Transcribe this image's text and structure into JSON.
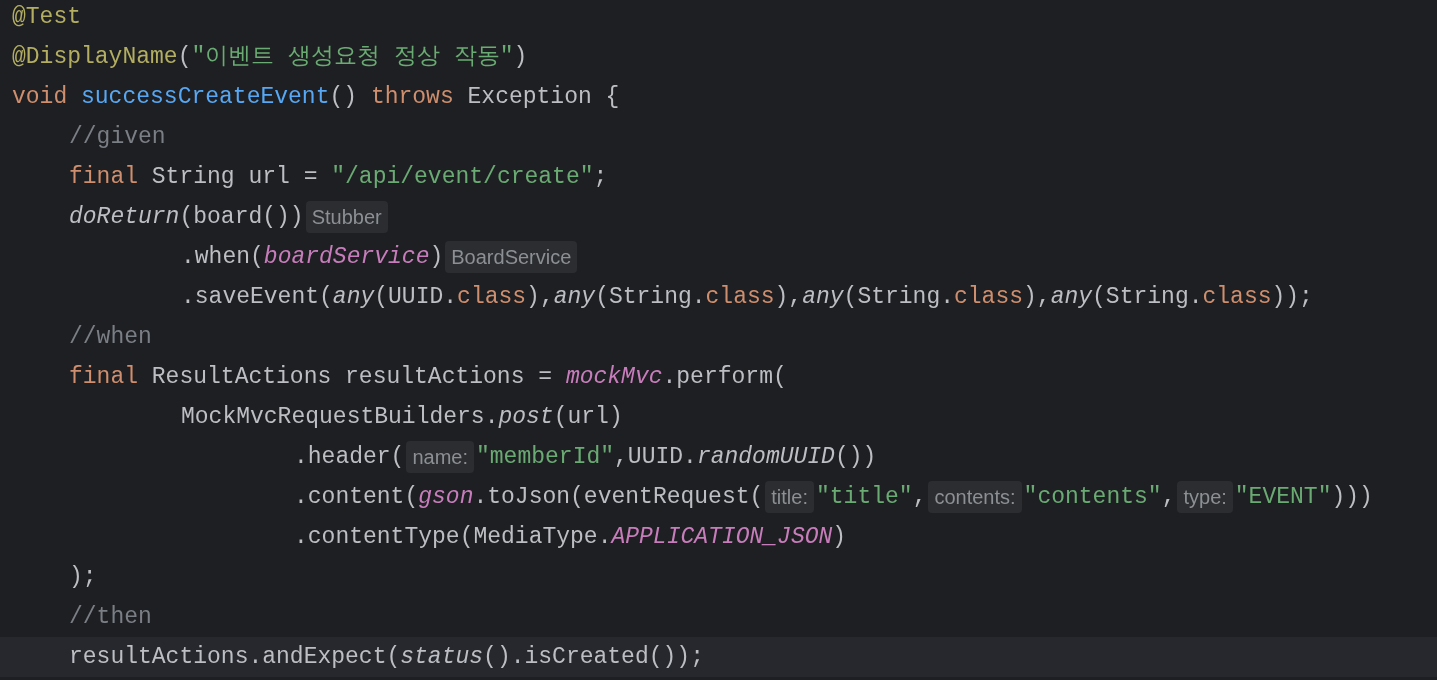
{
  "editor": {
    "lines": [
      {
        "current": false,
        "tokens": [
          {
            "kind": "annotation",
            "text": "@Test"
          }
        ]
      },
      {
        "current": false,
        "tokens": [
          {
            "kind": "annotation",
            "text": "@DisplayName"
          },
          {
            "kind": "plain",
            "text": "("
          },
          {
            "kind": "string",
            "text": "\"이벤트 생성요청 정상 작동\""
          },
          {
            "kind": "plain",
            "text": ")"
          }
        ]
      },
      {
        "current": false,
        "tokens": [
          {
            "kind": "keyword",
            "text": "void "
          },
          {
            "kind": "declaration",
            "text": "successCreateEvent"
          },
          {
            "kind": "plain",
            "text": "() "
          },
          {
            "kind": "keyword",
            "text": "throws"
          },
          {
            "kind": "plain",
            "text": " Exception {"
          }
        ],
        "children": [
          {
            "current": false,
            "tokens": [
              {
                "kind": "comment",
                "text": "//given"
              }
            ]
          },
          {
            "current": false,
            "tokens": [
              {
                "kind": "keyword",
                "text": "final"
              },
              {
                "kind": "plain",
                "text": " String url = "
              },
              {
                "kind": "string",
                "text": "\"/api/event/create\""
              },
              {
                "kind": "plain",
                "text": ";"
              }
            ]
          },
          {
            "current": false,
            "tokens": [
              {
                "kind": "static",
                "text": "doReturn"
              },
              {
                "kind": "plain",
                "text": "(board())"
              },
              {
                "kind": "hint",
                "text": "Stubber"
              }
            ],
            "children": [
              {
                "current": false,
                "tokens": [
                  {
                    "kind": "plain",
                    "text": ".when("
                  },
                  {
                    "kind": "field",
                    "text": "boardService"
                  },
                  {
                    "kind": "plain",
                    "text": ")"
                  },
                  {
                    "kind": "hint",
                    "text": "BoardService"
                  }
                ]
              },
              {
                "current": false,
                "tokens": [
                  {
                    "kind": "plain",
                    "text": ".saveEvent("
                  },
                  {
                    "kind": "static",
                    "text": "any"
                  },
                  {
                    "kind": "plain",
                    "text": "(UUID."
                  },
                  {
                    "kind": "keyword",
                    "text": "class"
                  },
                  {
                    "kind": "plain",
                    "text": "),"
                  },
                  {
                    "kind": "static",
                    "text": "any"
                  },
                  {
                    "kind": "plain",
                    "text": "(String."
                  },
                  {
                    "kind": "keyword",
                    "text": "class"
                  },
                  {
                    "kind": "plain",
                    "text": "),"
                  },
                  {
                    "kind": "static",
                    "text": "any"
                  },
                  {
                    "kind": "plain",
                    "text": "(String."
                  },
                  {
                    "kind": "keyword",
                    "text": "class"
                  },
                  {
                    "kind": "plain",
                    "text": "),"
                  },
                  {
                    "kind": "static",
                    "text": "any"
                  },
                  {
                    "kind": "plain",
                    "text": "(String."
                  },
                  {
                    "kind": "keyword",
                    "text": "class"
                  },
                  {
                    "kind": "plain",
                    "text": "));"
                  }
                ]
              }
            ]
          },
          {
            "current": false,
            "tokens": [
              {
                "kind": "comment",
                "text": "//when"
              }
            ]
          },
          {
            "current": false,
            "tokens": [
              {
                "kind": "keyword",
                "text": "final"
              },
              {
                "kind": "plain",
                "text": " ResultActions resultActions = "
              },
              {
                "kind": "field",
                "text": "mockMvc"
              },
              {
                "kind": "plain",
                "text": ".perform("
              }
            ],
            "children": [
              {
                "current": false,
                "tokens": [
                  {
                    "kind": "plain",
                    "text": "MockMvcRequestBuilders."
                  },
                  {
                    "kind": "static",
                    "text": "post"
                  },
                  {
                    "kind": "plain",
                    "text": "(url)"
                  }
                ],
                "children": [
                  {
                    "current": false,
                    "tokens": [
                      {
                        "kind": "plain",
                        "text": ".header("
                      },
                      {
                        "kind": "hint",
                        "text": "name:"
                      },
                      {
                        "kind": "string",
                        "text": "\"memberId\""
                      },
                      {
                        "kind": "plain",
                        "text": ",UUID."
                      },
                      {
                        "kind": "static",
                        "text": "randomUUID"
                      },
                      {
                        "kind": "plain",
                        "text": "())"
                      }
                    ]
                  },
                  {
                    "current": false,
                    "tokens": [
                      {
                        "kind": "plain",
                        "text": ".content("
                      },
                      {
                        "kind": "field",
                        "text": "gson"
                      },
                      {
                        "kind": "plain",
                        "text": ".toJson(eventRequest("
                      },
                      {
                        "kind": "hint",
                        "text": "title:"
                      },
                      {
                        "kind": "string",
                        "text": "\"title\""
                      },
                      {
                        "kind": "plain",
                        "text": ","
                      },
                      {
                        "kind": "hint",
                        "text": "contents:"
                      },
                      {
                        "kind": "string",
                        "text": "\"contents\""
                      },
                      {
                        "kind": "plain",
                        "text": ","
                      },
                      {
                        "kind": "hint",
                        "text": "type:"
                      },
                      {
                        "kind": "string",
                        "text": "\"EVENT\""
                      },
                      {
                        "kind": "plain",
                        "text": ")))"
                      }
                    ]
                  },
                  {
                    "current": false,
                    "tokens": [
                      {
                        "kind": "plain",
                        "text": ".contentType(MediaType."
                      },
                      {
                        "kind": "field",
                        "text": "APPLICATION_JSON"
                      },
                      {
                        "kind": "plain",
                        "text": ")"
                      }
                    ]
                  }
                ]
              }
            ]
          },
          {
            "current": false,
            "tokens": [
              {
                "kind": "plain",
                "text": ");"
              }
            ]
          },
          {
            "current": false,
            "tokens": [
              {
                "kind": "comment",
                "text": "//then"
              }
            ]
          },
          {
            "current": true,
            "tokens": [
              {
                "kind": "plain",
                "text": "resultActions.andExpect("
              },
              {
                "kind": "static",
                "text": "status"
              },
              {
                "kind": "plain",
                "text": "().isCreated());"
              }
            ]
          }
        ]
      }
    ]
  }
}
